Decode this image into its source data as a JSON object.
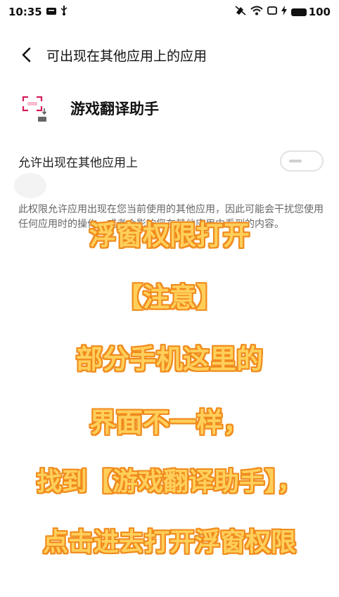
{
  "status_bar": {
    "time": "10:35",
    "battery": "100",
    "icons": [
      "message-icon",
      "usb-icon",
      "mute-icon",
      "wifi-icon",
      "screen-icon",
      "charging-icon",
      "battery-icon"
    ]
  },
  "header": {
    "back_icon": "chevron-left-icon",
    "title": "可出现在其他应用上的应用"
  },
  "app": {
    "name": "游戏翻译助手",
    "icon": "app-icon"
  },
  "permission": {
    "label": "允许出现在其他应用上",
    "toggle_state": "off"
  },
  "description": "此权限允许应用出现在您当前使用的其他应用，因此可能会干扰您使用任何应用时的操作，或者会影响您在其他应用中看到的内容。",
  "overlay_text": {
    "line1": "浮窗权限打开",
    "line2": "【注意】",
    "line3": "部分手机这里的",
    "line4": "界面不一样，",
    "line5": "找到【游戏翻译助手】，",
    "line6": "点击进去打开浮窗权限"
  },
  "colors": {
    "overlay_fill": "#ffcf5a",
    "overlay_outline": "#f08a1c",
    "app_icon_accent": "#d81b60"
  }
}
